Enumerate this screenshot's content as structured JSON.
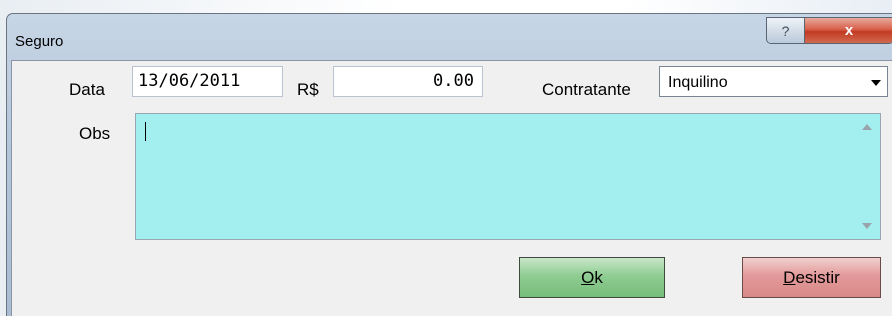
{
  "window": {
    "title": "Seguro",
    "help_label": "?",
    "close_label": "x"
  },
  "form": {
    "data_label": "Data",
    "data_value": "13/06/2011",
    "currency_label": "R$",
    "amount_value": "0.00",
    "contratante_label": "Contratante",
    "contratante_value": "Inquilino",
    "obs_label": "Obs",
    "obs_value": ""
  },
  "buttons": {
    "ok_first": "O",
    "ok_rest": "k",
    "cancel_first": "D",
    "cancel_rest": "esistir"
  },
  "colors": {
    "memo_bg": "#a3eff0",
    "ok_bg": "#8fcd92",
    "cancel_bg": "#e39a9a"
  },
  "icons": [
    "help-icon",
    "close-icon",
    "dropdown-arrow-icon",
    "scroll-up-icon",
    "scroll-down-icon"
  ]
}
